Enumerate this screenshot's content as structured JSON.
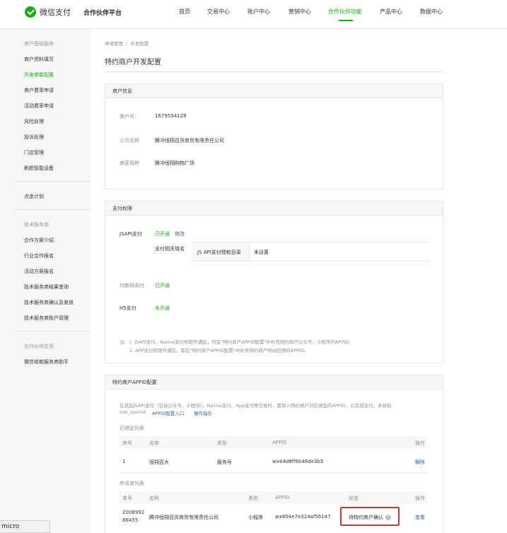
{
  "header": {
    "logo_text": "微信支付",
    "platform": "合作伙伴平台",
    "nav": [
      {
        "label": "首页"
      },
      {
        "label": "交易中心"
      },
      {
        "label": "账户中心"
      },
      {
        "label": "营销中心"
      },
      {
        "label": "合作伙伴功能"
      },
      {
        "label": "产品中心"
      },
      {
        "label": "数据中心"
      }
    ],
    "active_nav": "合作伙伴功能"
  },
  "sidebar": {
    "groups": [
      {
        "title": "商户基础服务",
        "items": [
          "商户资料填写",
          "开发参数配置",
          "商户费率申请",
          "活动费率申请",
          "风险处理",
          "投诉处理",
          "门店管理",
          "刷脸智能设备"
        ]
      },
      {
        "title": "",
        "items": [
          "点金计划"
        ]
      },
      {
        "title": "技术服务商",
        "items": [
          "合作方案介绍",
          "行业合作报名",
          "活动方案报名",
          "技术服务商结果查询",
          "技术服务商确认及发放",
          "技术服务商账户管理"
        ]
      },
      {
        "title": "合作伙伴应用",
        "items": [
          "微信收款服务商助手"
        ]
      }
    ],
    "active_item": "开发参数配置"
  },
  "breadcrumb": [
    "申请管理",
    "开发配置"
  ],
  "page_title": "特约商户开发配置",
  "merchant_info": {
    "header": "商户信息",
    "merchant_no_label": "商户号：",
    "merchant_no": "1679534128",
    "company_label": "公司名称",
    "company": "腾冲恒翔百货商贸有限责任公司",
    "short_name_label": "商家简称",
    "short_name": "腾冲恒翔购物广场"
  },
  "pay_permissions": {
    "header": "支付权限",
    "jsapi_label": "JSAPI支付",
    "jsapi_status": "已开通",
    "jsapi_modify": "修改",
    "domain_label": "支付相关域名",
    "js_api_dir_label": "JS API支付授权目录",
    "js_api_dir_value": "未设置",
    "micropay_label": "付款码支付",
    "micropay_status": "已开通",
    "h5_label": "H5支付",
    "h5_status": "未开通",
    "note_line1": "注：1. JSAPI支付、Native支付权限开通后，可在\"特约商户APPID配置\"中补充特约商户公众号，小程序的APPID；",
    "note_line2": "2. APP支付权限开通后，需在\"特约商户APPID配置\"中补充特约商户移动应用的APPID。"
  },
  "appid_config": {
    "header": "特约商户APPID配置",
    "desc_line1": "在发起JSAPI支付（包括公众号，小程序），Native支付、App支付等交易时，需将入特约商户对应类型的APPID，以完成支付，并获取",
    "desc_line2_prefix": "sub_openid",
    "desc_link1": "APPID配置入口",
    "desc_link2": "操作指引",
    "bound_title": "已绑定列表",
    "bound_columns": [
      "序号",
      "名称",
      "类型",
      "APPID",
      "操作"
    ],
    "bound_rows": [
      {
        "no": "1",
        "name": "恒翔百大",
        "type": "服务号",
        "appid": "wx44d8ff8b46de3b5",
        "action": "解除"
      }
    ],
    "apply_title": "申请单列表",
    "apply_columns": [
      "单号",
      "名称",
      "类型",
      "APPID",
      "状态",
      "操作"
    ],
    "apply_rows": [
      {
        "no_line1": "2008992",
        "no_line2": "88455",
        "name": "腾冲恒翔百货商贸有限责任公司",
        "type": "小程序",
        "appid": "wx854e7e324af56147",
        "status": "待特约商户确认",
        "status_help": "?",
        "action": "查看"
      }
    ]
  },
  "ime_indicator": "micro",
  "colors": {
    "accent": "#1aad19",
    "link": "#3a5e9c",
    "highlight": "#d9322e"
  }
}
